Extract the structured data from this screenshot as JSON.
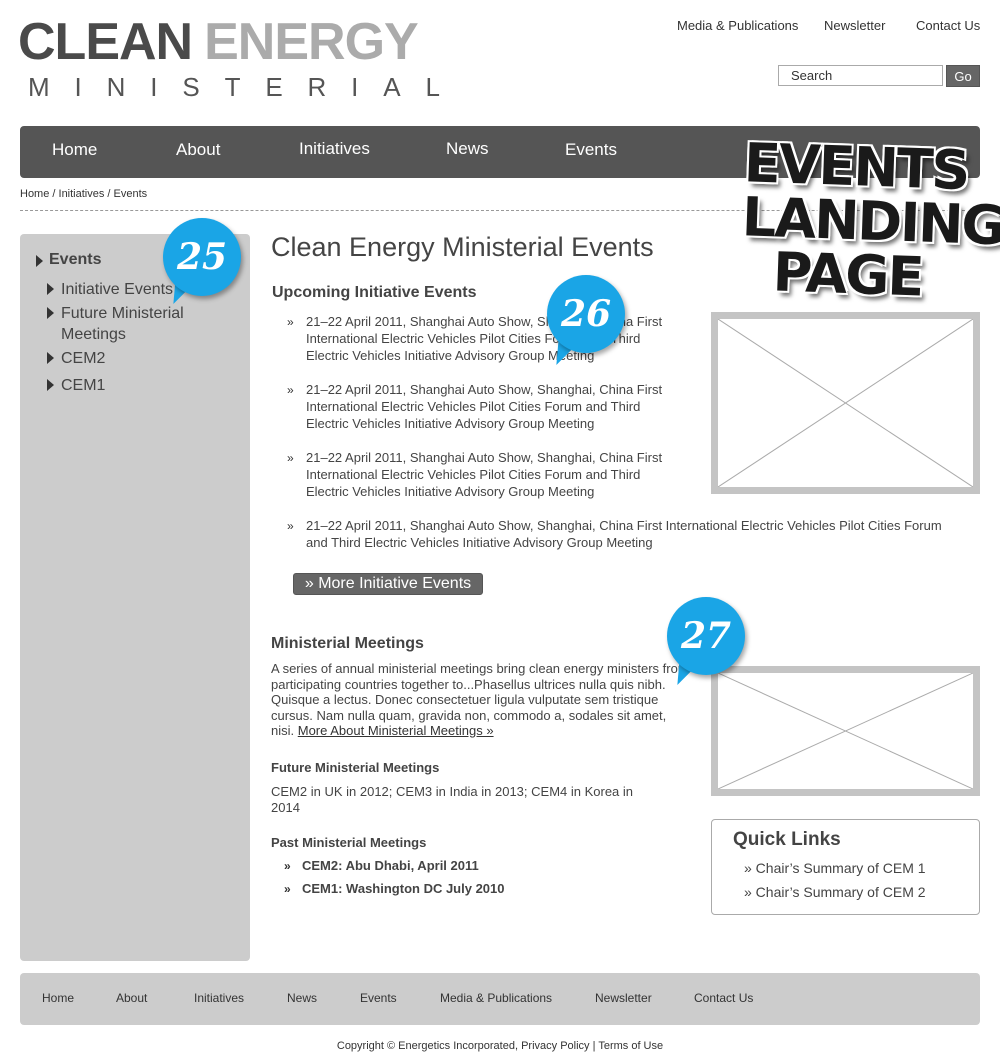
{
  "logo": {
    "word1": "CLEAN",
    "word2": "ENERGY",
    "sub_letters": [
      "M",
      "I",
      "N",
      "I",
      "S",
      "T",
      "E",
      "R",
      "I",
      "A",
      "L"
    ]
  },
  "utility_nav": [
    "Media & Publications",
    "Newsletter",
    "Contact Us"
  ],
  "search": {
    "placeholder": "Search",
    "button": "Go"
  },
  "main_nav": [
    "Home",
    "About",
    "Initiatives",
    "News",
    "Events"
  ],
  "stamp": {
    "line1": "EVENTS",
    "line2": "LANDING",
    "line3": "PAGE"
  },
  "breadcrumb": "Home / Initiatives / Events",
  "sidebar": {
    "title": "Events",
    "items": [
      {
        "label": "Initiative Events"
      },
      {
        "label": "Future Ministerial Meetings"
      },
      {
        "label": "CEM2"
      },
      {
        "label": "CEM1"
      }
    ]
  },
  "annotations": [
    "25",
    "26",
    "27"
  ],
  "page_title": "Clean Energy Ministerial Events",
  "upcoming": {
    "heading": "Upcoming Initiative Events",
    "bullet": "»",
    "events": [
      {
        "text": "21–22 April 2011, Shanghai Auto Show, Shanghai, China First International Electric Vehicles Pilot Cities Forum and Third Electric Vehicles Initiative Advisory Group Meeting"
      },
      {
        "text": "21–22 April 2011, Shanghai Auto Show, Shanghai, China First International Electric Vehicles Pilot Cities Forum and Third Electric Vehicles Initiative Advisory Group Meeting"
      },
      {
        "text": "21–22 April 2011, Shanghai Auto Show, Shanghai, China First International Electric Vehicles Pilot Cities Forum and Third Electric Vehicles Initiative Advisory Group Meeting"
      },
      {
        "text": "21–22 April 2011, Shanghai Auto Show, Shanghai, China  First International Electric Vehicles Pilot Cities Forum and Third Electric Vehicles Initiative Advisory Group Meeting"
      }
    ],
    "more_button": "» More Initiative Events"
  },
  "ministerial": {
    "heading": "Ministerial Meetings",
    "body": "A series of annual ministerial meetings bring clean energy ministers from participating countries together to...Phasellus ultrices nulla quis nibh. Quisque a lectus. Donec consectetuer ligula vulputate sem tristique cursus. Nam nulla quam, gravida non, commodo a, sodales sit amet, nisi.",
    "more_link": "More About Ministerial Meetings »",
    "future_heading": "Future Ministerial Meetings",
    "future_text": "CEM2 in UK in 2012; CEM3 in India in 2013; CEM4 in Korea in 2014",
    "past_heading": "Past Ministerial Meetings",
    "past_items": [
      "CEM2: Abu Dhabi, April 2011",
      "CEM1: Washington DC July 2010"
    ]
  },
  "quick_links": {
    "title": "Quick Links",
    "items": [
      "» Chair’s Summary of CEM 1",
      "» Chair’s Summary of CEM 2"
    ]
  },
  "footer_nav": [
    "Home",
    "About",
    "Initiatives",
    "News",
    "Events",
    "Media & Publications",
    "Newsletter",
    "Contact Us"
  ],
  "copyright": {
    "prefix": "Copyright © Energetics Incorporated, ",
    "privacy": "Privacy Policy",
    "sep": " |  ",
    "terms": "Terms of Use"
  },
  "colors": {
    "nav_bg": "#555555",
    "sidebar_bg": "#cccccc",
    "bubble": "#1aa5e6",
    "placeholder_border": "#c4c4c4"
  }
}
